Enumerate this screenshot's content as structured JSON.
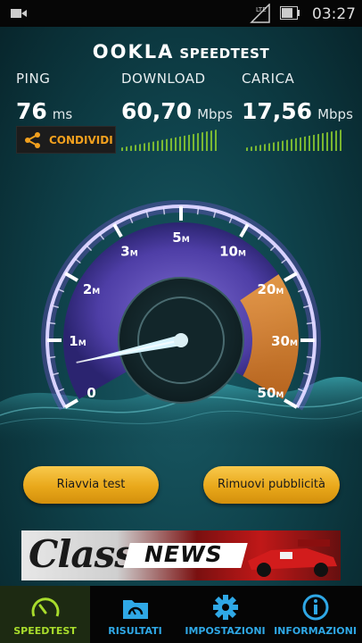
{
  "status_bar": {
    "time": "03:27",
    "network": "LTE"
  },
  "header": {
    "brand": "OOKLA",
    "product": "SPEEDTEST"
  },
  "metrics": {
    "ping": {
      "label": "PING",
      "value": "76",
      "unit": "ms"
    },
    "download": {
      "label": "DOWNLOAD",
      "value": "60,70",
      "unit": "Mbps"
    },
    "upload": {
      "label": "CARICA",
      "value": "17,56",
      "unit": "Mbps"
    }
  },
  "share_button": {
    "label": "CONDIVIDI",
    "icon": "share-icon"
  },
  "gauge": {
    "ticks": [
      {
        "num": "0",
        "unit": ""
      },
      {
        "num": "1",
        "unit": "M"
      },
      {
        "num": "2",
        "unit": "M"
      },
      {
        "num": "3",
        "unit": "M"
      },
      {
        "num": "5",
        "unit": "M"
      },
      {
        "num": "10",
        "unit": "M"
      },
      {
        "num": "20",
        "unit": "M"
      },
      {
        "num": "30",
        "unit": "M"
      },
      {
        "num": "50",
        "unit": "M"
      }
    ],
    "needle_value_mbps": 0.6,
    "colors": {
      "ring": "#7b56d6",
      "accent": "#f08a1c",
      "needle": "#d8f4ff"
    }
  },
  "buttons": {
    "restart": "Riavvia test",
    "remove_ads": "Rimuovi pubblicità"
  },
  "ad": {
    "word1": "Class",
    "word2": "NEWS"
  },
  "tabs": [
    {
      "label": "SPEEDTEST",
      "icon": "speedometer-icon",
      "active": true
    },
    {
      "label": "RISULTATI",
      "icon": "folder-icon",
      "active": false
    },
    {
      "label": "IMPOSTAZIONI",
      "icon": "gear-icon",
      "active": false
    },
    {
      "label": "INFORMAZIONI",
      "icon": "info-icon",
      "active": false
    }
  ],
  "theme": {
    "accent_green": "#a8dc2c",
    "accent_blue": "#2fa8e6",
    "accent_orange": "#f2a01e"
  }
}
